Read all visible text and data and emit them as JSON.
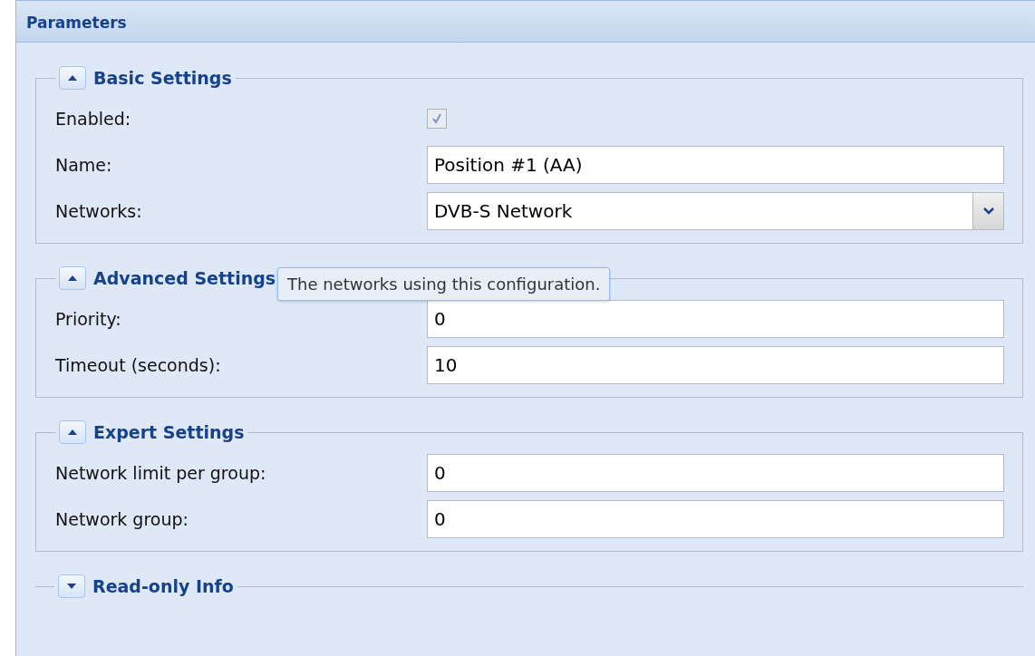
{
  "panel": {
    "title": "Parameters"
  },
  "groups": [
    {
      "title": "Basic Settings",
      "expanded": true,
      "fields": [
        {
          "kind": "checkbox",
          "label": "Enabled:",
          "checked": true,
          "disabled": true
        },
        {
          "kind": "text",
          "label": "Name:",
          "value": "Position #1 (AA)"
        },
        {
          "kind": "combo",
          "label": "Networks:",
          "value": "DVB-S Network"
        }
      ]
    },
    {
      "title": "Advanced Settings",
      "expanded": true,
      "fields": [
        {
          "kind": "text",
          "label": "Priority:",
          "value": "0"
        },
        {
          "kind": "text",
          "label": "Timeout (seconds):",
          "value": "10"
        }
      ]
    },
    {
      "title": "Expert Settings",
      "expanded": true,
      "fields": [
        {
          "kind": "text",
          "label": "Network limit per group:",
          "value": "0"
        },
        {
          "kind": "text",
          "label": "Network group:",
          "value": "0"
        }
      ]
    },
    {
      "title": "Read-only Info",
      "expanded": false
    }
  ],
  "tooltip": {
    "text": "The networks using this configuration."
  }
}
